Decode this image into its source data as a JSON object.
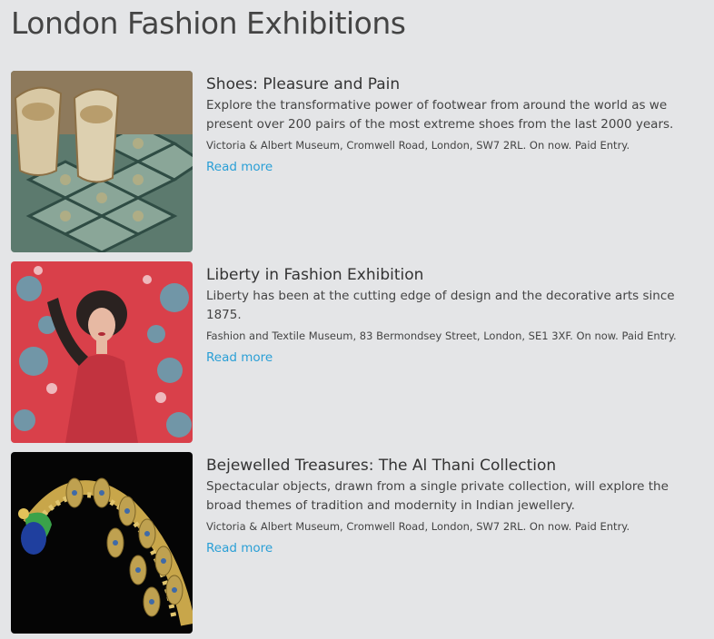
{
  "page": {
    "title": "London Fashion Exhibitions"
  },
  "exhibitions": [
    {
      "title": "Shoes: Pleasure and Pain",
      "description": "Explore the transformative power of footwear from around the world as we present over 200 pairs of the most extreme shoes from the last 2000 years.",
      "venue": "Victoria & Albert Museum, Cromwell Road, London, SW7 2RL. On now. Paid Entry.",
      "link_label": "Read more"
    },
    {
      "title": "Liberty in Fashion Exhibition",
      "description": "Liberty has been at the cutting edge of design and the decorative arts since 1875.",
      "venue": "Fashion and Textile Museum, 83 Bermondsey Street, London, SE1 3XF. On now. Paid Entry.",
      "link_label": "Read more"
    },
    {
      "title": "Bejewelled Treasures: The Al Thani Collection",
      "description": "Spectacular objects, drawn from a single private collection, will explore the broad themes of tradition and modernity in Indian jewellery.",
      "venue": "Victoria & Albert Museum, Cromwell Road, London, SW7 2RL. On now. Paid Entry.",
      "link_label": "Read more"
    }
  ],
  "colors": {
    "background": "#e4e5e7",
    "link": "#2a9fd6",
    "text": "#333333"
  }
}
